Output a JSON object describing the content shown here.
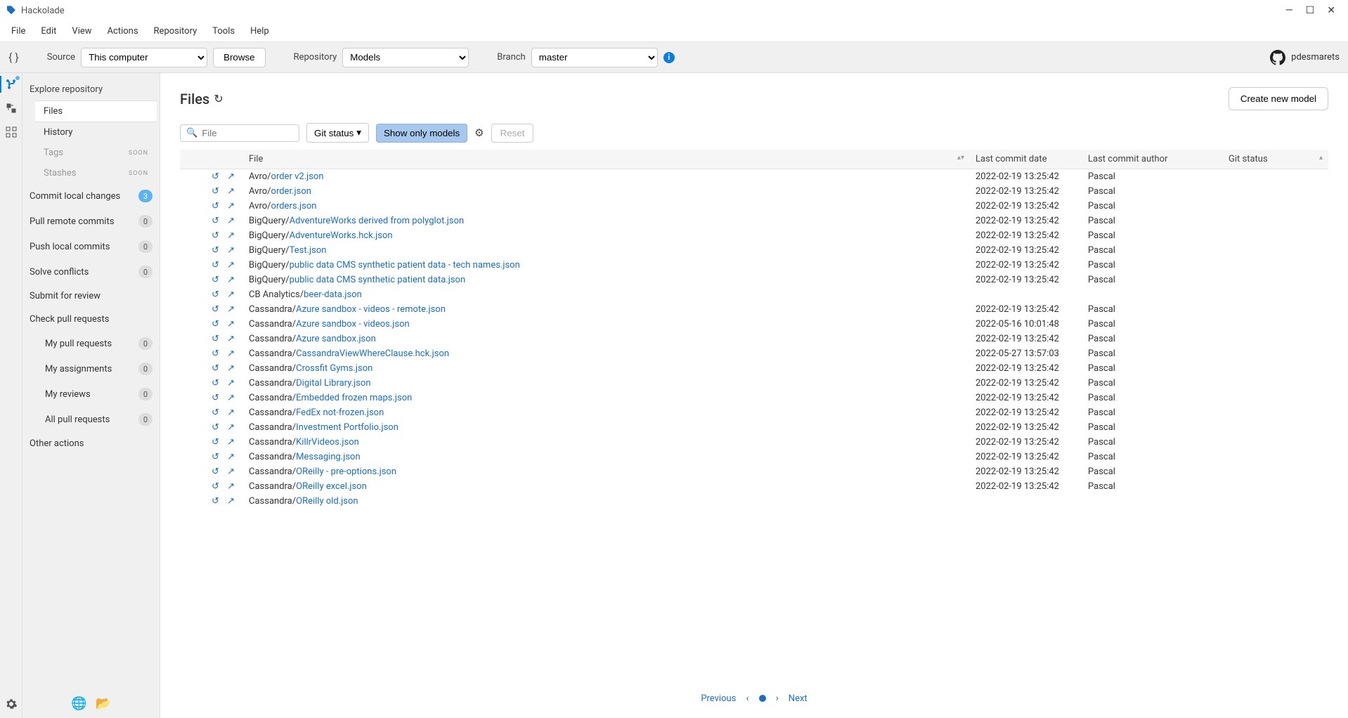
{
  "app": {
    "title": "Hackolade"
  },
  "menus": [
    "File",
    "Edit",
    "View",
    "Actions",
    "Repository",
    "Tools",
    "Help"
  ],
  "toolbar": {
    "source_label": "Source",
    "source_value": "This computer",
    "browse": "Browse",
    "repo_label": "Repository",
    "repo_value": "Models",
    "branch_label": "Branch",
    "branch_value": "master",
    "username": "pdesmarets"
  },
  "sidebar": {
    "header": "Explore repository",
    "tabs": [
      {
        "label": "Files",
        "active": true
      },
      {
        "label": "History",
        "active": false
      },
      {
        "label": "Tags",
        "active": false,
        "soon": "SOON"
      },
      {
        "label": "Stashes",
        "active": false,
        "soon": "SOON"
      }
    ],
    "actions": [
      {
        "label": "Commit local changes",
        "count": "3",
        "blue": true
      },
      {
        "label": "Pull remote commits",
        "count": "0"
      },
      {
        "label": "Push local commits",
        "count": "0"
      },
      {
        "label": "Solve conflicts",
        "count": "0"
      },
      {
        "label": "Submit for review"
      },
      {
        "label": "Check pull requests"
      }
    ],
    "pr": [
      {
        "label": "My pull requests",
        "count": "0"
      },
      {
        "label": "My assignments",
        "count": "0"
      },
      {
        "label": "My reviews",
        "count": "0"
      },
      {
        "label": "All pull requests",
        "count": "0"
      }
    ],
    "other": "Other actions"
  },
  "content": {
    "title": "Files",
    "search_placeholder": "File",
    "git_status_label": "Git status",
    "show_only_models": "Show only models",
    "reset": "Reset",
    "create": "Create new model",
    "columns": {
      "file": "File",
      "date": "Last commit date",
      "author": "Last commit author",
      "status": "Git status"
    },
    "pager": {
      "prev": "Previous",
      "next": "Next"
    }
  },
  "files": [
    {
      "prefix": "Avro/",
      "name": "order v2.json",
      "date": "2022-02-19 13:25:42",
      "author": "Pascal"
    },
    {
      "prefix": "Avro/",
      "name": "order.json",
      "date": "2022-02-19 13:25:42",
      "author": "Pascal"
    },
    {
      "prefix": "Avro/",
      "name": "orders.json",
      "date": "2022-02-19 13:25:42",
      "author": "Pascal"
    },
    {
      "prefix": "BigQuery/",
      "name": "AdventureWorks derived from polyglot.json",
      "date": "2022-02-19 13:25:42",
      "author": "Pascal"
    },
    {
      "prefix": "BigQuery/",
      "name": "AdventureWorks.hck.json",
      "date": "2022-02-19 13:25:42",
      "author": "Pascal"
    },
    {
      "prefix": "BigQuery/",
      "name": "Test.json",
      "date": "2022-02-19 13:25:42",
      "author": "Pascal"
    },
    {
      "prefix": "BigQuery/",
      "name": "public data CMS synthetic patient data - tech names.json",
      "date": "2022-02-19 13:25:42",
      "author": "Pascal"
    },
    {
      "prefix": "BigQuery/",
      "name": "public data CMS synthetic patient data.json",
      "date": "2022-02-19 13:25:42",
      "author": "Pascal"
    },
    {
      "prefix": "CB Analytics/",
      "name": "beer-data.json",
      "date": "",
      "author": ""
    },
    {
      "prefix": "Cassandra/",
      "name": "Azure sandbox - videos - remote.json",
      "date": "2022-02-19 13:25:42",
      "author": "Pascal"
    },
    {
      "prefix": "Cassandra/",
      "name": "Azure sandbox - videos.json",
      "date": "2022-05-16 10:01:48",
      "author": "Pascal"
    },
    {
      "prefix": "Cassandra/",
      "name": "Azure sandbox.json",
      "date": "2022-02-19 13:25:42",
      "author": "Pascal"
    },
    {
      "prefix": "Cassandra/",
      "name": "CassandraViewWhereClause.hck.json",
      "date": "2022-05-27 13:57:03",
      "author": "Pascal"
    },
    {
      "prefix": "Cassandra/",
      "name": "Crossfit Gyms.json",
      "date": "2022-02-19 13:25:42",
      "author": "Pascal"
    },
    {
      "prefix": "Cassandra/",
      "name": "Digital Library.json",
      "date": "2022-02-19 13:25:42",
      "author": "Pascal"
    },
    {
      "prefix": "Cassandra/",
      "name": "Embedded frozen maps.json",
      "date": "2022-02-19 13:25:42",
      "author": "Pascal"
    },
    {
      "prefix": "Cassandra/",
      "name": "FedEx not-frozen.json",
      "date": "2022-02-19 13:25:42",
      "author": "Pascal"
    },
    {
      "prefix": "Cassandra/",
      "name": "Investment Portfolio.json",
      "date": "2022-02-19 13:25:42",
      "author": "Pascal"
    },
    {
      "prefix": "Cassandra/",
      "name": "KillrVideos.json",
      "date": "2022-02-19 13:25:42",
      "author": "Pascal"
    },
    {
      "prefix": "Cassandra/",
      "name": "Messaging.json",
      "date": "2022-02-19 13:25:42",
      "author": "Pascal"
    },
    {
      "prefix": "Cassandra/",
      "name": "OReilly - pre-options.json",
      "date": "2022-02-19 13:25:42",
      "author": "Pascal"
    },
    {
      "prefix": "Cassandra/",
      "name": "OReilly excel.json",
      "date": "2022-02-19 13:25:42",
      "author": "Pascal"
    },
    {
      "prefix": "Cassandra/",
      "name": "OReilly old.json",
      "date": "",
      "author": ""
    }
  ]
}
